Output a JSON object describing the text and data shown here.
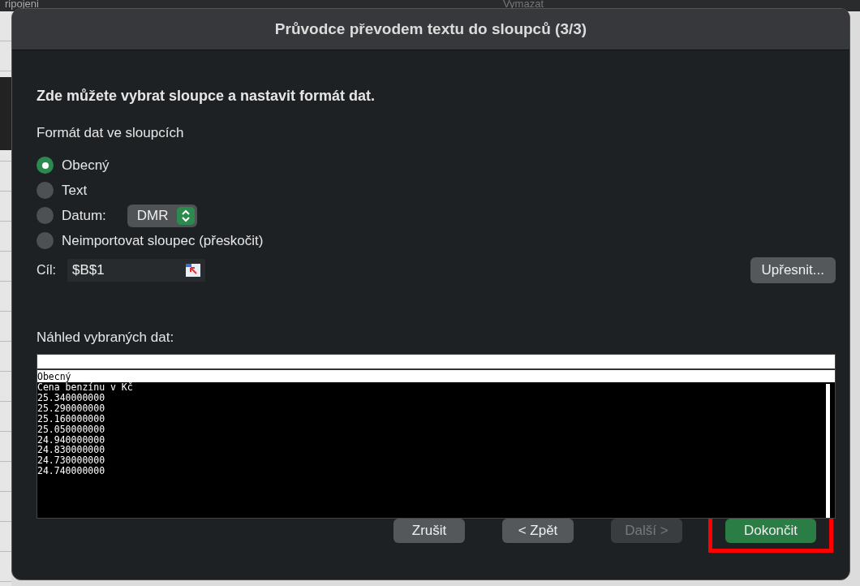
{
  "background": {
    "texts": [
      "ripojeni",
      "Vymazat"
    ]
  },
  "window": {
    "title": "Průvodce převodem textu do sloupců (3/3)"
  },
  "heading": "Zde můžete vybrat sloupce a nastavit formát dat.",
  "format_group": {
    "label": "Formát dat ve sloupcích",
    "options": [
      {
        "kind": "plain",
        "label": "Obecný",
        "selected": true
      },
      {
        "kind": "plain",
        "label": "Text",
        "selected": false
      },
      {
        "kind": "date",
        "label": "Datum:",
        "selected": false,
        "popup_value": "DMR"
      },
      {
        "kind": "plain",
        "label": "Neimportovat sloupec (přeskočit)",
        "selected": false
      }
    ]
  },
  "destination": {
    "label": "Cíl:",
    "value": "$B$1"
  },
  "advanced_button": "Upřesnit...",
  "preview": {
    "label": "Náhled vybraných dat:",
    "column_format": "Obecný",
    "rows": [
      "Cena benzínu v Kč",
      "25.340000000",
      "25.290000000",
      "25.160000000",
      "25.050000000",
      "24.940000000",
      "24.830000000",
      "24.730000000",
      "24.740000000"
    ]
  },
  "buttons": [
    {
      "label": "Zrušit",
      "kind": "normal",
      "disabled": false,
      "highlighted": false
    },
    {
      "label": "< Zpět",
      "kind": "normal",
      "disabled": false,
      "highlighted": false
    },
    {
      "label": "Další >",
      "kind": "normal",
      "disabled": true,
      "highlighted": false
    },
    {
      "label": "Dokončit",
      "kind": "default",
      "disabled": false,
      "highlighted": true
    }
  ]
}
